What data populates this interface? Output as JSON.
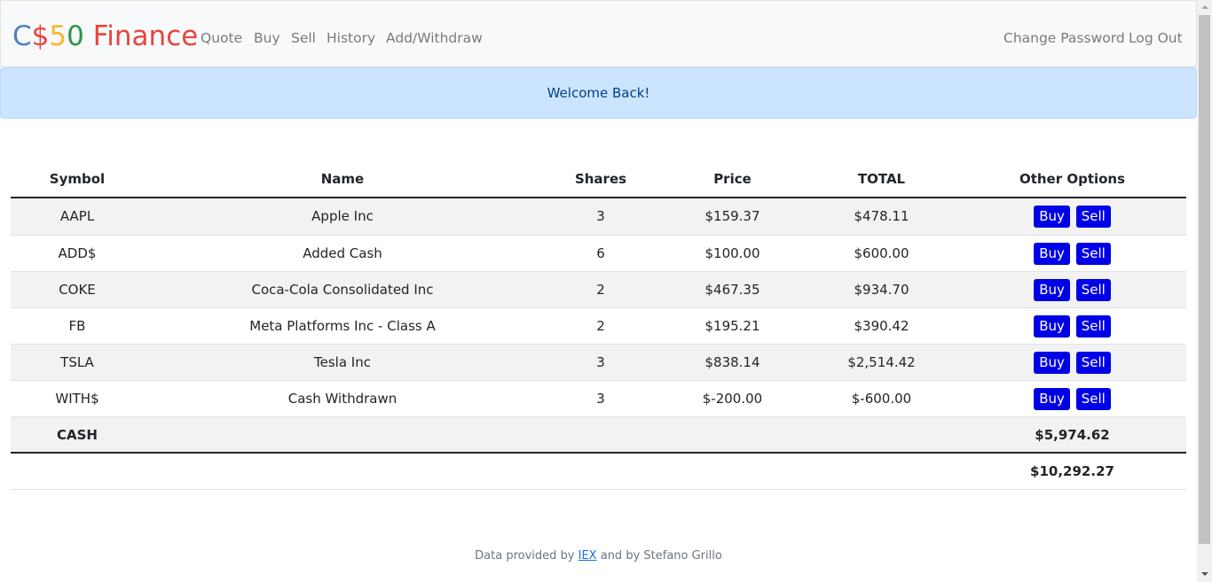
{
  "brand": {
    "parts": [
      {
        "text": "C",
        "color": "#537fbe"
      },
      {
        "text": "$",
        "color": "#ea433b"
      },
      {
        "text": "5",
        "color": "#f5b82e"
      },
      {
        "text": "0",
        "color": "#2e944b"
      },
      {
        "text": " Finance",
        "color": "#ea433b"
      }
    ]
  },
  "nav": {
    "left": [
      "Quote",
      "Buy",
      "Sell",
      "History",
      "Add/Withdraw"
    ],
    "right": [
      "Change Password",
      "Log Out"
    ]
  },
  "alert": {
    "text": "Welcome Back!"
  },
  "table": {
    "headers": [
      "Symbol",
      "Name",
      "Shares",
      "Price",
      "TOTAL",
      "Other Options"
    ],
    "rows": [
      {
        "symbol": "AAPL",
        "name": "Apple Inc",
        "shares": "3",
        "price": "$159.37",
        "total": "$478.11"
      },
      {
        "symbol": "ADD$",
        "name": "Added Cash",
        "shares": "6",
        "price": "$100.00",
        "total": "$600.00"
      },
      {
        "symbol": "COKE",
        "name": "Coca-Cola Consolidated Inc",
        "shares": "2",
        "price": "$467.35",
        "total": "$934.70"
      },
      {
        "symbol": "FB",
        "name": "Meta Platforms Inc - Class A",
        "shares": "2",
        "price": "$195.21",
        "total": "$390.42"
      },
      {
        "symbol": "TSLA",
        "name": "Tesla Inc",
        "shares": "3",
        "price": "$838.14",
        "total": "$2,514.42"
      },
      {
        "symbol": "WITH$",
        "name": "Cash Withdrawn",
        "shares": "3",
        "price": "$-200.00",
        "total": "$-600.00"
      }
    ],
    "buy_label": "Buy",
    "sell_label": "Sell",
    "cash_label": "CASH",
    "cash_value": "$5,974.62",
    "grand_total": "$10,292.27"
  },
  "footer": {
    "prefix": "Data provided by ",
    "link": "IEX",
    "suffix": " and by Stefano Grillo"
  }
}
